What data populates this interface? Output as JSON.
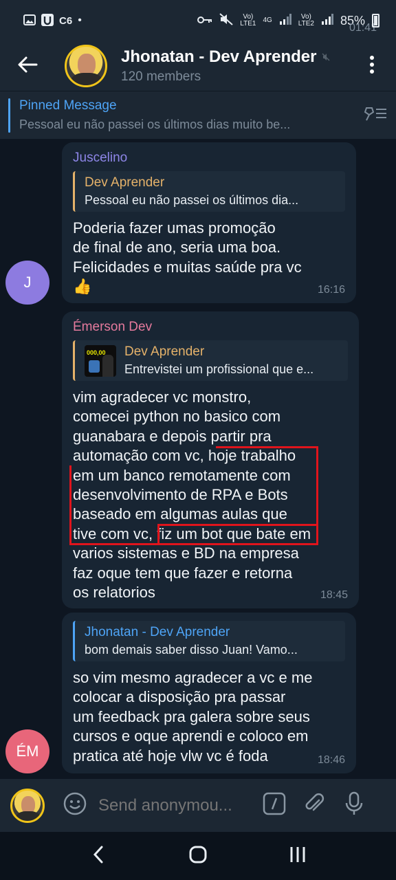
{
  "status_bar": {
    "time": "01:41",
    "left_icons": [
      "gallery-icon",
      "u-icon",
      "c6-icon",
      "dot-icon"
    ],
    "c6_label": "C6",
    "network_1": "VoLTE1",
    "network_type": "4G",
    "network_2": "VoLTE2",
    "battery": "85%"
  },
  "header": {
    "title": "Jhonatan - Dev Aprender",
    "subtitle": "120 members"
  },
  "pinned": {
    "title": "Pinned Message",
    "preview": "Pessoal eu não passei os últimos dias muito be..."
  },
  "messages": [
    {
      "sender": "Juscelino",
      "sender_color": "#8e86e8",
      "avatar_letter": "J",
      "avatar_color": "#8d7be0",
      "reply_name": "Dev Aprender",
      "reply_preview": "Pessoal eu não passei os últimos dia...",
      "text": "Poderia fazer umas promoção\nde final de ano, seria uma boa.\nFelicidades e muitas saúde pra vc\n👍",
      "time": "16:16"
    },
    {
      "sender": "Émerson Dev",
      "sender_color": "#e57a9d",
      "reply_name": "Dev Aprender",
      "reply_preview": "Entrevistei um profissional que e...",
      "reply_thumb_label": "000,00",
      "text": "vim agradecer vc monstro,\ncomecei python no basico com\nguanabara e depois partir pra\nautomação com vc, hoje trabalho\nem um banco remotamente com\ndesenvolvimento de RPA e Bots\nbaseado em algumas aulas que\ntive com vc, fiz um bot que bate em\nvarios sistemas e BD na empresa\nfaz oque tem que fazer e retorna\nos relatorios",
      "time": "18:45"
    },
    {
      "avatar_letter": "ÉM",
      "avatar_color": "#e8667a",
      "reply_name": "Jhonatan - Dev Aprender",
      "reply_preview": "bom demais saber disso Juan! Vamo...",
      "text": "so vim mesmo agradecer a vc e me\ncolocar a disposição pra passar\num feedback pra galera sobre seus\ncursos e oque aprendi e coloco em\npratica até hoje vlw vc é foda",
      "time": "18:46"
    }
  ],
  "composer": {
    "placeholder": "Send anonymou..."
  },
  "colors": {
    "background": "#0e1621",
    "header": "#1c2733",
    "bubble": "#182533",
    "accent": "#4ea4f6",
    "reply_gold": "#e5b26a",
    "highlight_red": "#e0141c"
  }
}
